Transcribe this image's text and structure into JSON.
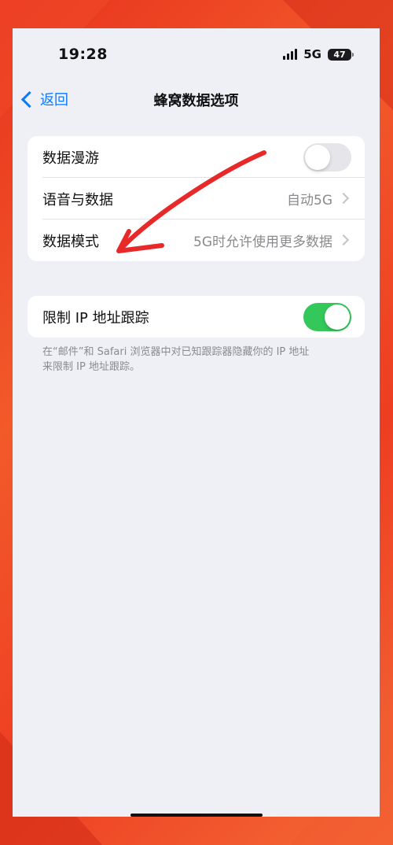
{
  "status_bar": {
    "time": "19:28",
    "network": "5G",
    "battery": "47"
  },
  "nav": {
    "back_label": "返回",
    "title": "蜂窝数据选项"
  },
  "cellular_group": {
    "items": [
      {
        "label": "数据漫游",
        "toggle_on": false
      },
      {
        "label": "语音与数据",
        "value": "自动5G"
      },
      {
        "label": "数据模式",
        "value": "5G时允许使用更多数据"
      }
    ]
  },
  "privacy_group": {
    "label": "限制 IP 地址跟踪",
    "toggle_on": true,
    "footnote_line1": "在“邮件”和 Safari 浏览器中对已知跟踪器隐藏你的 IP 地址",
    "footnote_line2": "来限制 IP 地址跟踪。"
  },
  "colors": {
    "accent": "#0a7aff",
    "toggle_on": "#34c759",
    "annotation": "#e8292a",
    "background": "#efeff6"
  }
}
